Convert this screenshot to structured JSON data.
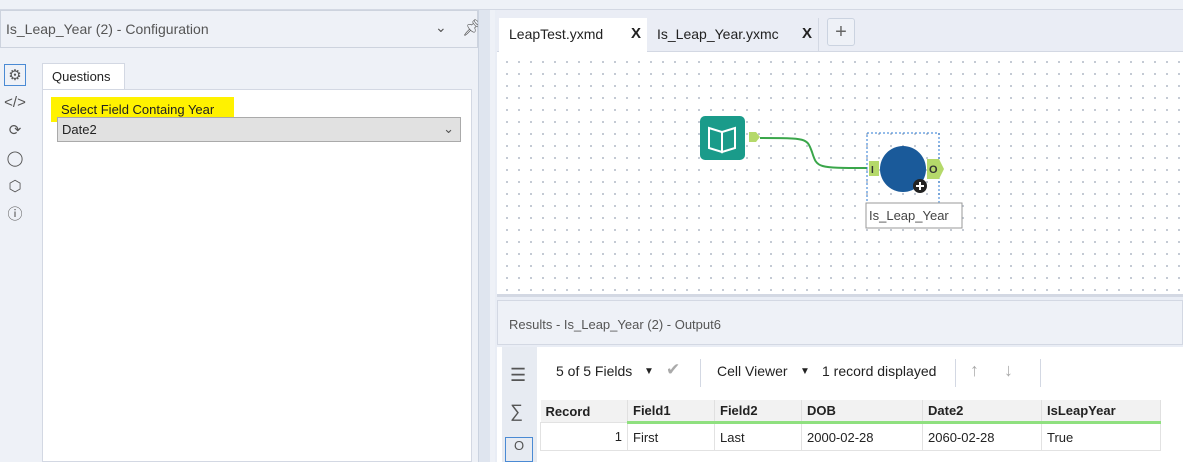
{
  "config": {
    "title": "Is_Leap_Year (2) - Configuration",
    "tab": "Questions",
    "field_label": "Select Field Containg Year",
    "field_value": "Date2"
  },
  "sidebar_icons": [
    "gear-icon",
    "code-icon",
    "connection-icon",
    "tag-icon",
    "package-icon",
    "help-icon"
  ],
  "tabs": [
    {
      "label": "LeapTest.yxmd",
      "close": "X"
    },
    {
      "label": "Is_Leap_Year.yxmc",
      "close": "X"
    }
  ],
  "add_tab": "+",
  "canvas": {
    "tool_label": "Is_Leap_Year",
    "input_anchor": "I",
    "output_anchor": "O",
    "connection_color": "#3aa64a",
    "macro_color": "#1a5a9a",
    "input_tool_color": "#1a9b8a"
  },
  "results": {
    "title": "Results - Is_Leap_Year (2) - Output6",
    "fields_selector": "5 of 5 Fields",
    "cell_viewer": "Cell Viewer",
    "record_count": "1 record displayed",
    "columns": [
      "Record",
      "Field1",
      "Field2",
      "DOB",
      "Date2",
      "IsLeapYear"
    ],
    "rows": [
      [
        "1",
        "First",
        "Last",
        "2000-02-28",
        "2060-02-28",
        "True"
      ]
    ]
  }
}
